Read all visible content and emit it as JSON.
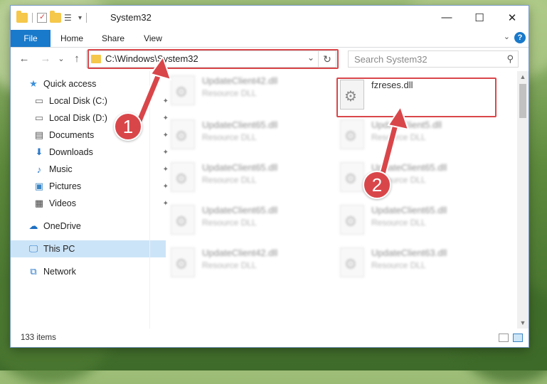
{
  "window": {
    "title": "System32",
    "controls": {
      "minimize": "—",
      "maximize": "☐",
      "close": "✕"
    }
  },
  "ribbon": {
    "tabs": [
      "File",
      "Home",
      "Share",
      "View"
    ],
    "help": "?",
    "collapse": "⌄"
  },
  "nav": {
    "back": "←",
    "forward": "→",
    "recent": "⌄",
    "up": "↑",
    "address": "C:\\Windows\\System32",
    "address_dropdown": "⌄",
    "refresh": "↻",
    "search_placeholder": "Search System32",
    "search_icon": "search-icon"
  },
  "sidebar": {
    "items": [
      {
        "label": "Quick access",
        "icon": "star-icon",
        "pinned": false
      },
      {
        "label": "Local Disk (C:)",
        "icon": "drive-icon",
        "pinned": true
      },
      {
        "label": "Local Disk (D:)",
        "icon": "drive-icon",
        "pinned": true
      },
      {
        "label": "Documents",
        "icon": "document-icon",
        "pinned": true
      },
      {
        "label": "Downloads",
        "icon": "download-icon",
        "pinned": true
      },
      {
        "label": "Music",
        "icon": "music-icon",
        "pinned": true
      },
      {
        "label": "Pictures",
        "icon": "pictures-icon",
        "pinned": true
      },
      {
        "label": "Videos",
        "icon": "videos-icon",
        "pinned": true
      },
      {
        "label": "OneDrive",
        "icon": "cloud-icon",
        "pinned": false
      },
      {
        "label": "This PC",
        "icon": "computer-icon",
        "pinned": false,
        "selected": true
      },
      {
        "label": "Network",
        "icon": "network-icon",
        "pinned": false
      }
    ],
    "pin_glyph": "📌"
  },
  "files": [
    {
      "name": "UpdateClient42.dll",
      "type": "Resource DLL",
      "blurred": true
    },
    {
      "name": "fzreses.dll",
      "type": "",
      "blurred": false,
      "highlighted": true
    },
    {
      "name": "UpdateClient65.dll",
      "type": "Resource DLL",
      "blurred": true
    },
    {
      "name": "UpdateClient5.dll",
      "type": "Resource DLL",
      "blurred": true
    },
    {
      "name": "UpdateClient65.dll",
      "type": "Resource DLL",
      "blurred": true
    },
    {
      "name": "UpdateClient65.dll",
      "type": "Resource DLL",
      "blurred": true
    },
    {
      "name": "UpdateClient65.dll",
      "type": "Resource DLL",
      "blurred": true
    },
    {
      "name": "UpdateClient65.dll",
      "type": "Resource DLL",
      "blurred": true
    },
    {
      "name": "UpdateClient42.dll",
      "type": "Resource DLL",
      "blurred": true
    },
    {
      "name": "UpdateClient63.dll",
      "type": "Resource DLL",
      "blurred": true
    }
  ],
  "status": {
    "item_count": "133 items"
  },
  "annotations": {
    "step1": "1",
    "step2": "2",
    "color": "#d9464a"
  }
}
